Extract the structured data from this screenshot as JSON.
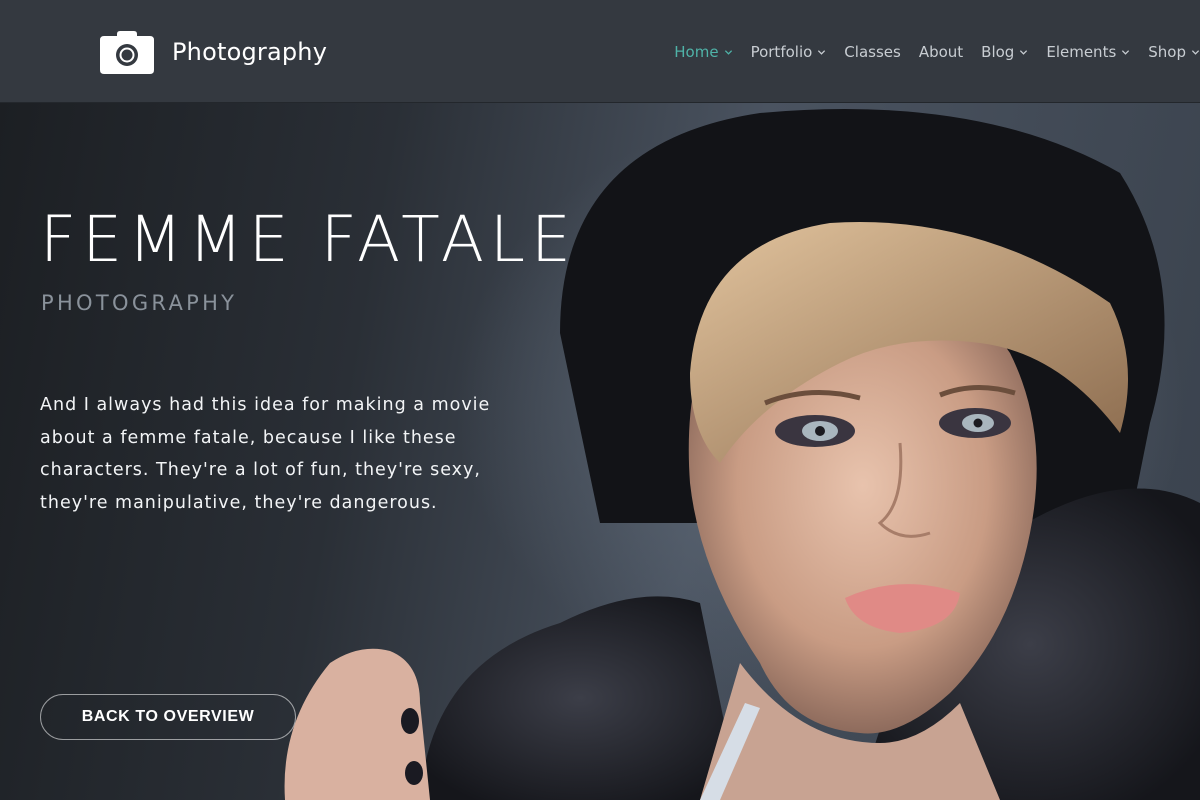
{
  "header": {
    "brand": "Photography",
    "logo_icon": "camera-icon",
    "nav": [
      {
        "label": "Home",
        "dropdown": true,
        "active": true
      },
      {
        "label": "Portfolio",
        "dropdown": true,
        "active": false
      },
      {
        "label": "Classes",
        "dropdown": false,
        "active": false
      },
      {
        "label": "About",
        "dropdown": false,
        "active": false
      },
      {
        "label": "Blog",
        "dropdown": true,
        "active": false
      },
      {
        "label": "Elements",
        "dropdown": true,
        "active": false
      },
      {
        "label": "Shop",
        "dropdown": true,
        "active": false
      }
    ],
    "colors": {
      "active": "#4fb3a8",
      "nav_text": "#c8cdd2",
      "bar_bg": "#343940"
    }
  },
  "hero": {
    "title": "FEMME FATALE",
    "subtitle": "PHOTOGRAPHY",
    "quote_lines": [
      "And I always had this idea for making a movie",
      "about a femme fatale, because I like these",
      "characters. They're a lot of fun, they're sexy,",
      "they're manipulative, they're dangerous."
    ],
    "button_label": "BACK TO OVERVIEW"
  }
}
